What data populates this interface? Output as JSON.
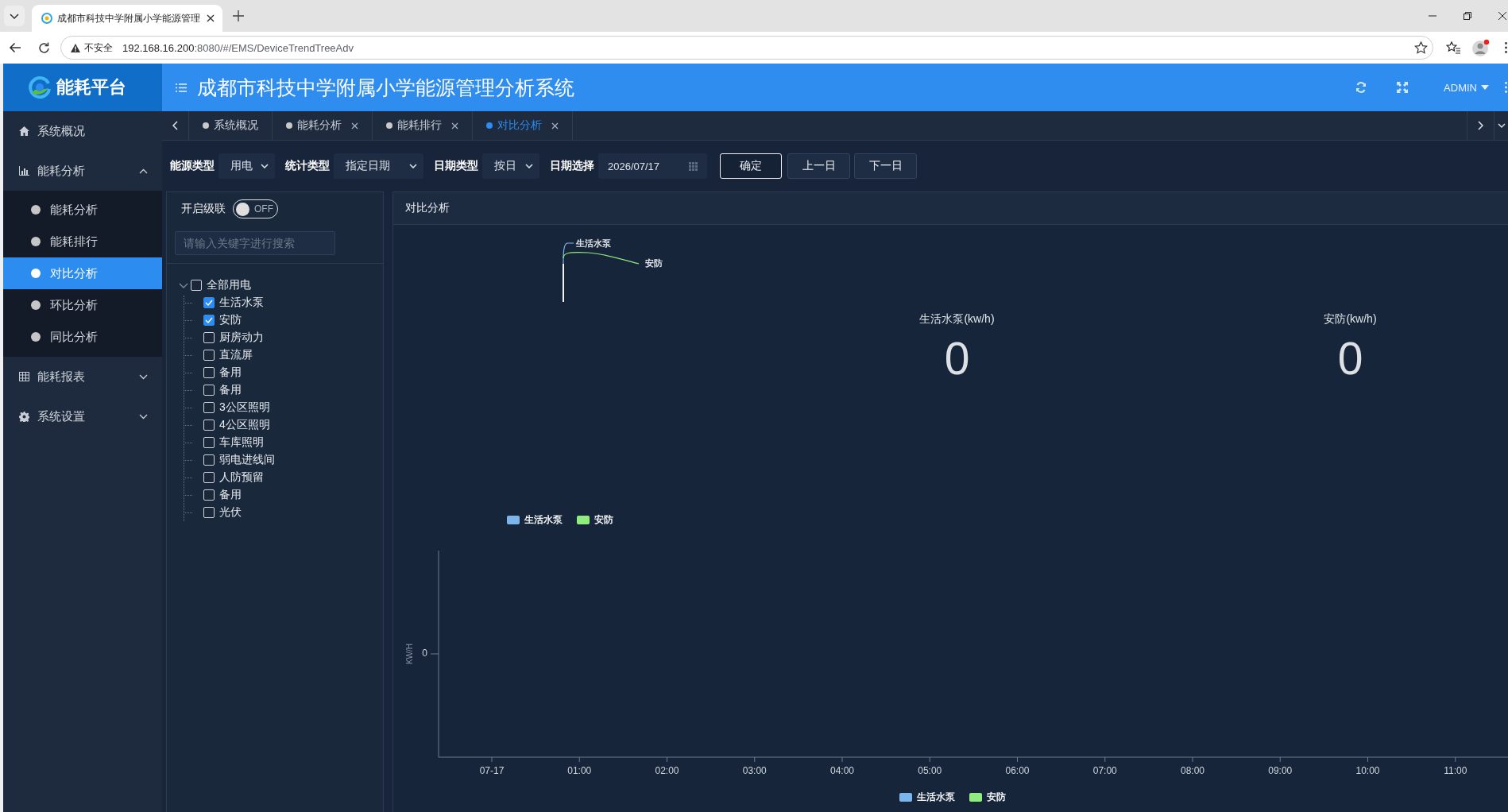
{
  "browser": {
    "tab_title": "成都市科技中学附属小学能源管理",
    "security_label": "不安全",
    "url_host": "192.168.16.200",
    "url_rest": ":8080/#/EMS/DeviceTrendTreeAdv"
  },
  "header": {
    "logo_text": "能耗平台",
    "title": "成都市科技中学附属小学能源管理分析系统",
    "user": "ADMIN"
  },
  "sidebar": {
    "items": [
      {
        "kind": "link",
        "label": "系统概况",
        "selected": false
      },
      {
        "kind": "group",
        "label": "能耗分析",
        "expanded": true,
        "children": [
          {
            "label": "能耗分析",
            "selected": false
          },
          {
            "label": "能耗排行",
            "selected": false
          },
          {
            "label": "对比分析",
            "selected": true
          },
          {
            "label": "环比分析",
            "selected": false
          },
          {
            "label": "同比分析",
            "selected": false
          }
        ]
      },
      {
        "kind": "group",
        "label": "能耗报表",
        "expanded": false
      },
      {
        "kind": "group",
        "label": "系统设置",
        "expanded": false
      }
    ]
  },
  "tabs": [
    {
      "label": "系统概况",
      "closable": false,
      "selected": false
    },
    {
      "label": "能耗分析",
      "closable": true,
      "selected": false
    },
    {
      "label": "能耗排行",
      "closable": true,
      "selected": false
    },
    {
      "label": "对比分析",
      "closable": true,
      "selected": true
    }
  ],
  "filters": [
    {
      "kind": "select",
      "label": "能源类型",
      "value": "用电"
    },
    {
      "kind": "select",
      "label": "统计类型",
      "value": "指定日期"
    },
    {
      "kind": "select",
      "label": "日期类型",
      "value": "按日"
    },
    {
      "kind": "date",
      "label": "日期选择",
      "value": "2026/07/17"
    }
  ],
  "buttons": [
    {
      "kind": "primary",
      "label": "确定"
    },
    {
      "kind": "default",
      "label": "上一日"
    },
    {
      "kind": "default",
      "label": "下一日"
    }
  ],
  "tree_panel": {
    "cascade": {
      "label": "开启级联",
      "on": false,
      "state_text": "OFF"
    },
    "search": {
      "placeholder": "请输入关键字进行搜索"
    },
    "tree": [
      {
        "label": "全部用电",
        "checked": false,
        "expanded": true,
        "children": [
          {
            "label": "生活水泵",
            "checked": true
          },
          {
            "label": "安防",
            "checked": true
          },
          {
            "label": "厨房动力",
            "checked": false
          },
          {
            "label": "直流屏",
            "checked": false
          },
          {
            "label": "备用",
            "checked": false
          },
          {
            "label": "备用",
            "checked": false
          },
          {
            "label": "3公区照明",
            "checked": false
          },
          {
            "label": "4公区照明",
            "checked": false
          },
          {
            "label": "车库照明",
            "checked": false
          },
          {
            "label": "弱电进线间",
            "checked": false
          },
          {
            "label": "人防预留",
            "checked": false
          },
          {
            "label": "备用",
            "checked": false
          },
          {
            "label": "光伏",
            "checked": false
          }
        ]
      }
    ]
  },
  "compare_panel": {
    "title": "对比分析",
    "pie": {
      "labels": [
        "生活水泵",
        "安防"
      ],
      "legend": [
        {
          "name": "生活水泵",
          "color": "#7cb5ec"
        },
        {
          "name": "安防",
          "color": "#90ed7d"
        }
      ]
    },
    "stats": [
      {
        "label": "生活水泵(kw/h)",
        "value": "0"
      },
      {
        "label": "安防(kw/h)",
        "value": "0"
      }
    ],
    "line_chart": {
      "y_axis_title": "KW/H",
      "y_tick_labels": [
        "0"
      ],
      "x_tick_labels": [
        "07-17",
        "01:00",
        "02:00",
        "03:00",
        "04:00",
        "05:00",
        "06:00",
        "07:00",
        "08:00",
        "09:00",
        "10:00",
        "11:00"
      ],
      "legend": [
        {
          "name": "生活水泵",
          "color": "#7cb5ec"
        },
        {
          "name": "安防",
          "color": "#90ed7d"
        }
      ]
    }
  }
}
